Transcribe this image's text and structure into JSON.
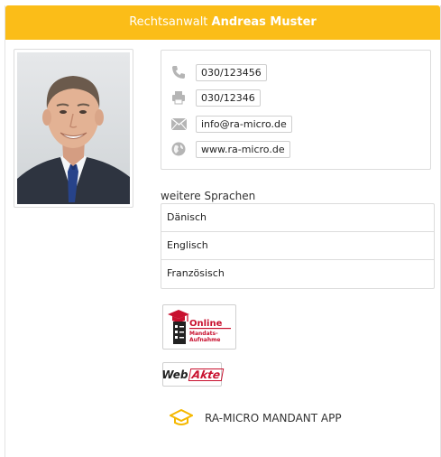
{
  "header": {
    "prefix": "Rechtsanwalt",
    "name": "Andreas Muster"
  },
  "contact": {
    "phone": "030/123456",
    "fax": "030/12346",
    "email": "info@ra-micro.de",
    "website": "www.ra-micro.de"
  },
  "languages": {
    "title": "weitere Sprachen",
    "items": [
      "Dänisch",
      "Englisch",
      "Französisch"
    ]
  },
  "badges": {
    "online_line1": "Online",
    "online_line2": "Mandats-",
    "online_line3": "Aufnahme",
    "webakte_web": "Web",
    "webakte_akte": "Akte"
  },
  "app": {
    "label": "RA-MICRO MANDANT APP"
  },
  "colors": {
    "header_bg": "#fbbd18",
    "icon_gray": "#b5b5b5",
    "brand_red": "#c8102e",
    "app_icon": "#f5b800"
  }
}
